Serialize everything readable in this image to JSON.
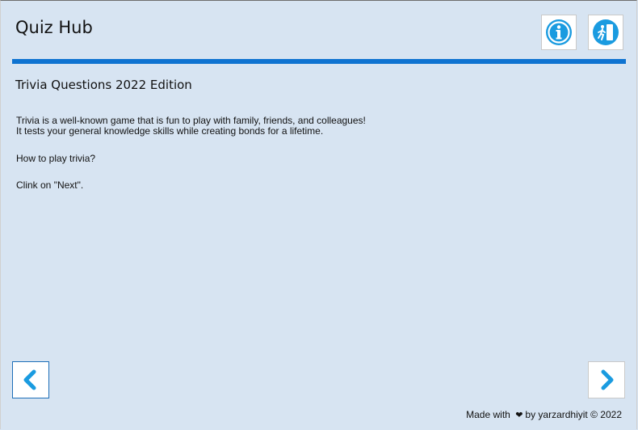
{
  "window": {
    "title": "Quiz Hub"
  },
  "toolbar": {
    "info_icon": "info-icon",
    "exit_icon": "exit-door-icon"
  },
  "page": {
    "title": "Trivia Questions 2022 Edition",
    "intro_line1": "Trivia is a well-known game that is fun to play with family, friends, and colleagues!",
    "intro_line2": "It tests your general knowledge skills while creating bonds for a lifetime.",
    "question": "How to play trivia?",
    "instruction": "Clink on \"Next\"."
  },
  "navigation": {
    "prev_icon": "chevron-left-icon",
    "next_icon": "chevron-right-icon"
  },
  "footer": {
    "made_with": "Made with",
    "heart": "❤",
    "by": "by yarzardhiyit",
    "copyright": "© 2022"
  },
  "colors": {
    "background": "#d7e4f2",
    "accent": "#0f73d1",
    "icon_blue": "#1a9be0"
  }
}
